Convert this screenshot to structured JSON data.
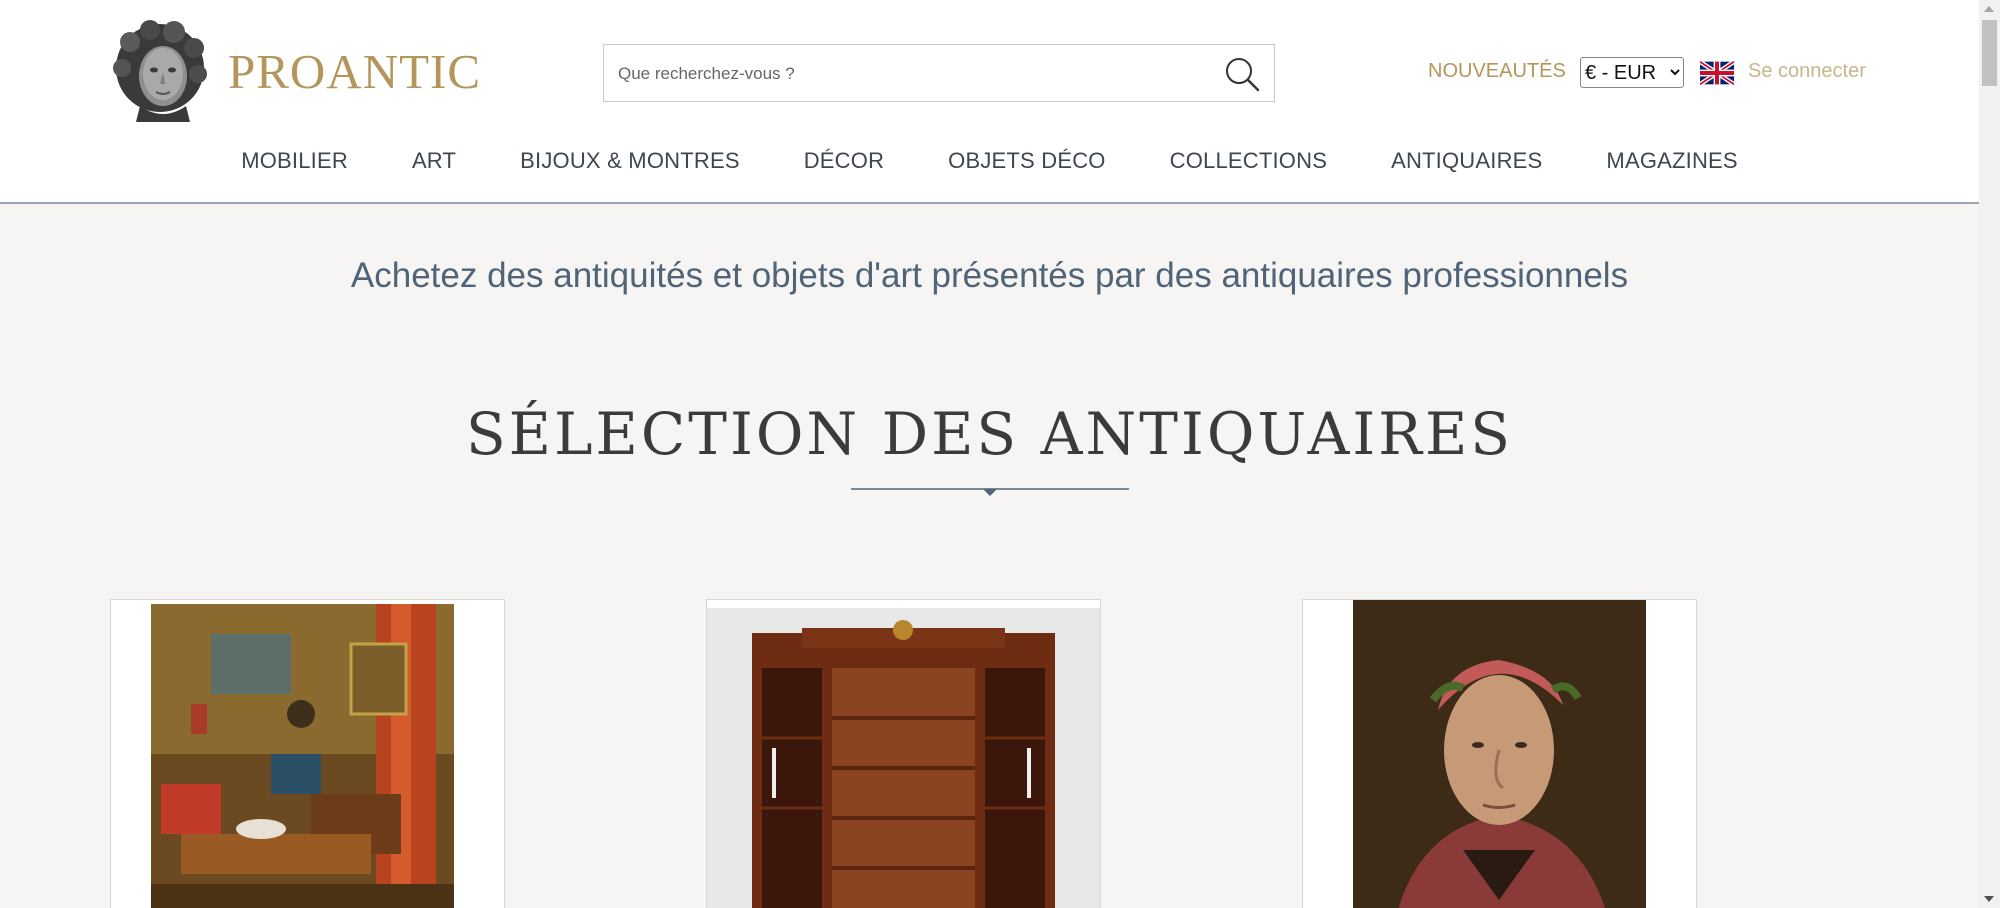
{
  "brand": {
    "name": "PROANTIC",
    "logo_icon": "bust-icon"
  },
  "search": {
    "placeholder": "Que recherchez-vous ?",
    "icon": "search-icon"
  },
  "topbar": {
    "new_label": "NOUVEAUTÉS",
    "currency_selected": "€ - EUR",
    "language_icon": "uk-flag-icon",
    "login_label": "Se connecter"
  },
  "nav": {
    "items": [
      "MOBILIER",
      "ART",
      "BIJOUX & MONTRES",
      "DÉCOR",
      "OBJETS DÉCO",
      "COLLECTIONS",
      "ANTIQUAIRES",
      "MAGAZINES"
    ]
  },
  "tagline": "Achetez des antiquités et objets d'art présentés par des antiquaires professionnels",
  "section": {
    "title": "SÉLECTION DES ANTIQUAIRES"
  },
  "products": [
    {
      "image": "painting-interior-image"
    },
    {
      "image": "mahogany-bookcase-image"
    },
    {
      "image": "portrait-dante-image"
    }
  ],
  "colors": {
    "gold": "#b4965a",
    "navy": "#4f6479",
    "background": "#f6f5f3"
  }
}
